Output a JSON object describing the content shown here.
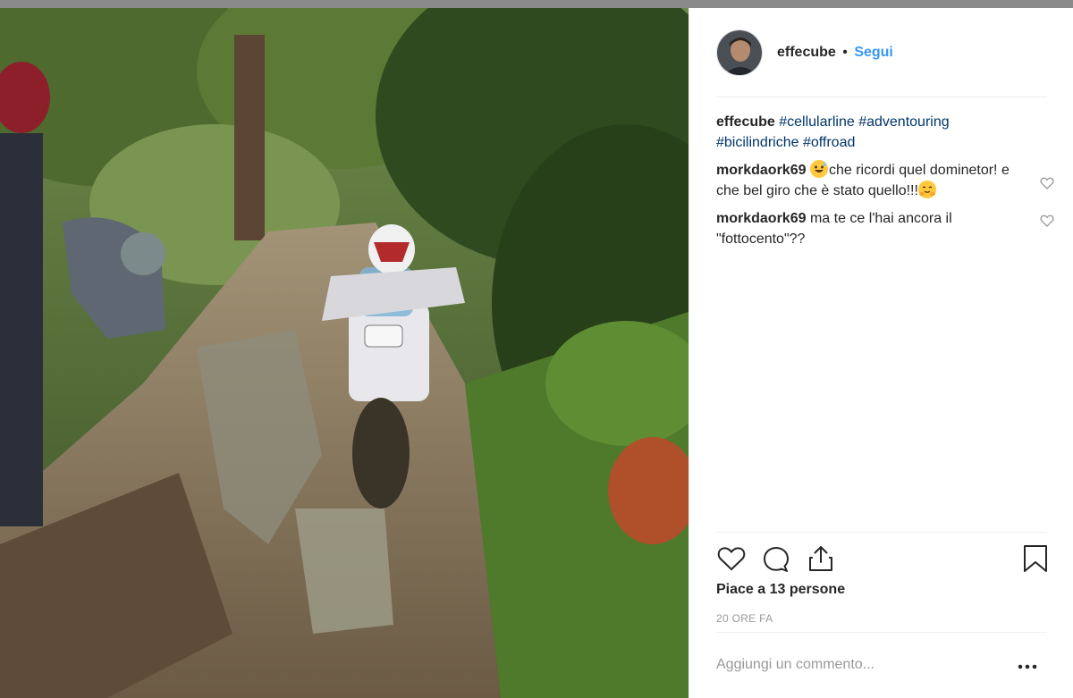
{
  "post": {
    "username": "effecube",
    "separator": "•",
    "follow_label": "Segui"
  },
  "caption": {
    "username": "effecube",
    "hashtags": [
      "#cellularline",
      "#adventouring",
      "#bicilindriche",
      "#offroad"
    ]
  },
  "comments": [
    {
      "username": "morkdaork69",
      "text_before_emoji": "",
      "emoji_name": "grinning-sweat-emoji",
      "text": "che ricordi quel dominetor! e che bel giro che è stato quello!!!",
      "trailing_emoji_name": "hugging-face-emoji"
    },
    {
      "username": "morkdaork69",
      "text": "ma te ce l'hai ancora il \"fottocento\"??"
    }
  ],
  "likes_text": "Piace a 13 persone",
  "timestamp": "20 ORE FA",
  "add_comment_placeholder": "Aggiungi un commento...",
  "more_label": "•••",
  "colors": {
    "link": "#3897f0",
    "hashtag": "#003569",
    "muted": "#999999",
    "border": "#efefef"
  },
  "icons": [
    "heart-icon",
    "comment-icon",
    "share-icon",
    "bookmark-icon",
    "more-options-icon"
  ]
}
